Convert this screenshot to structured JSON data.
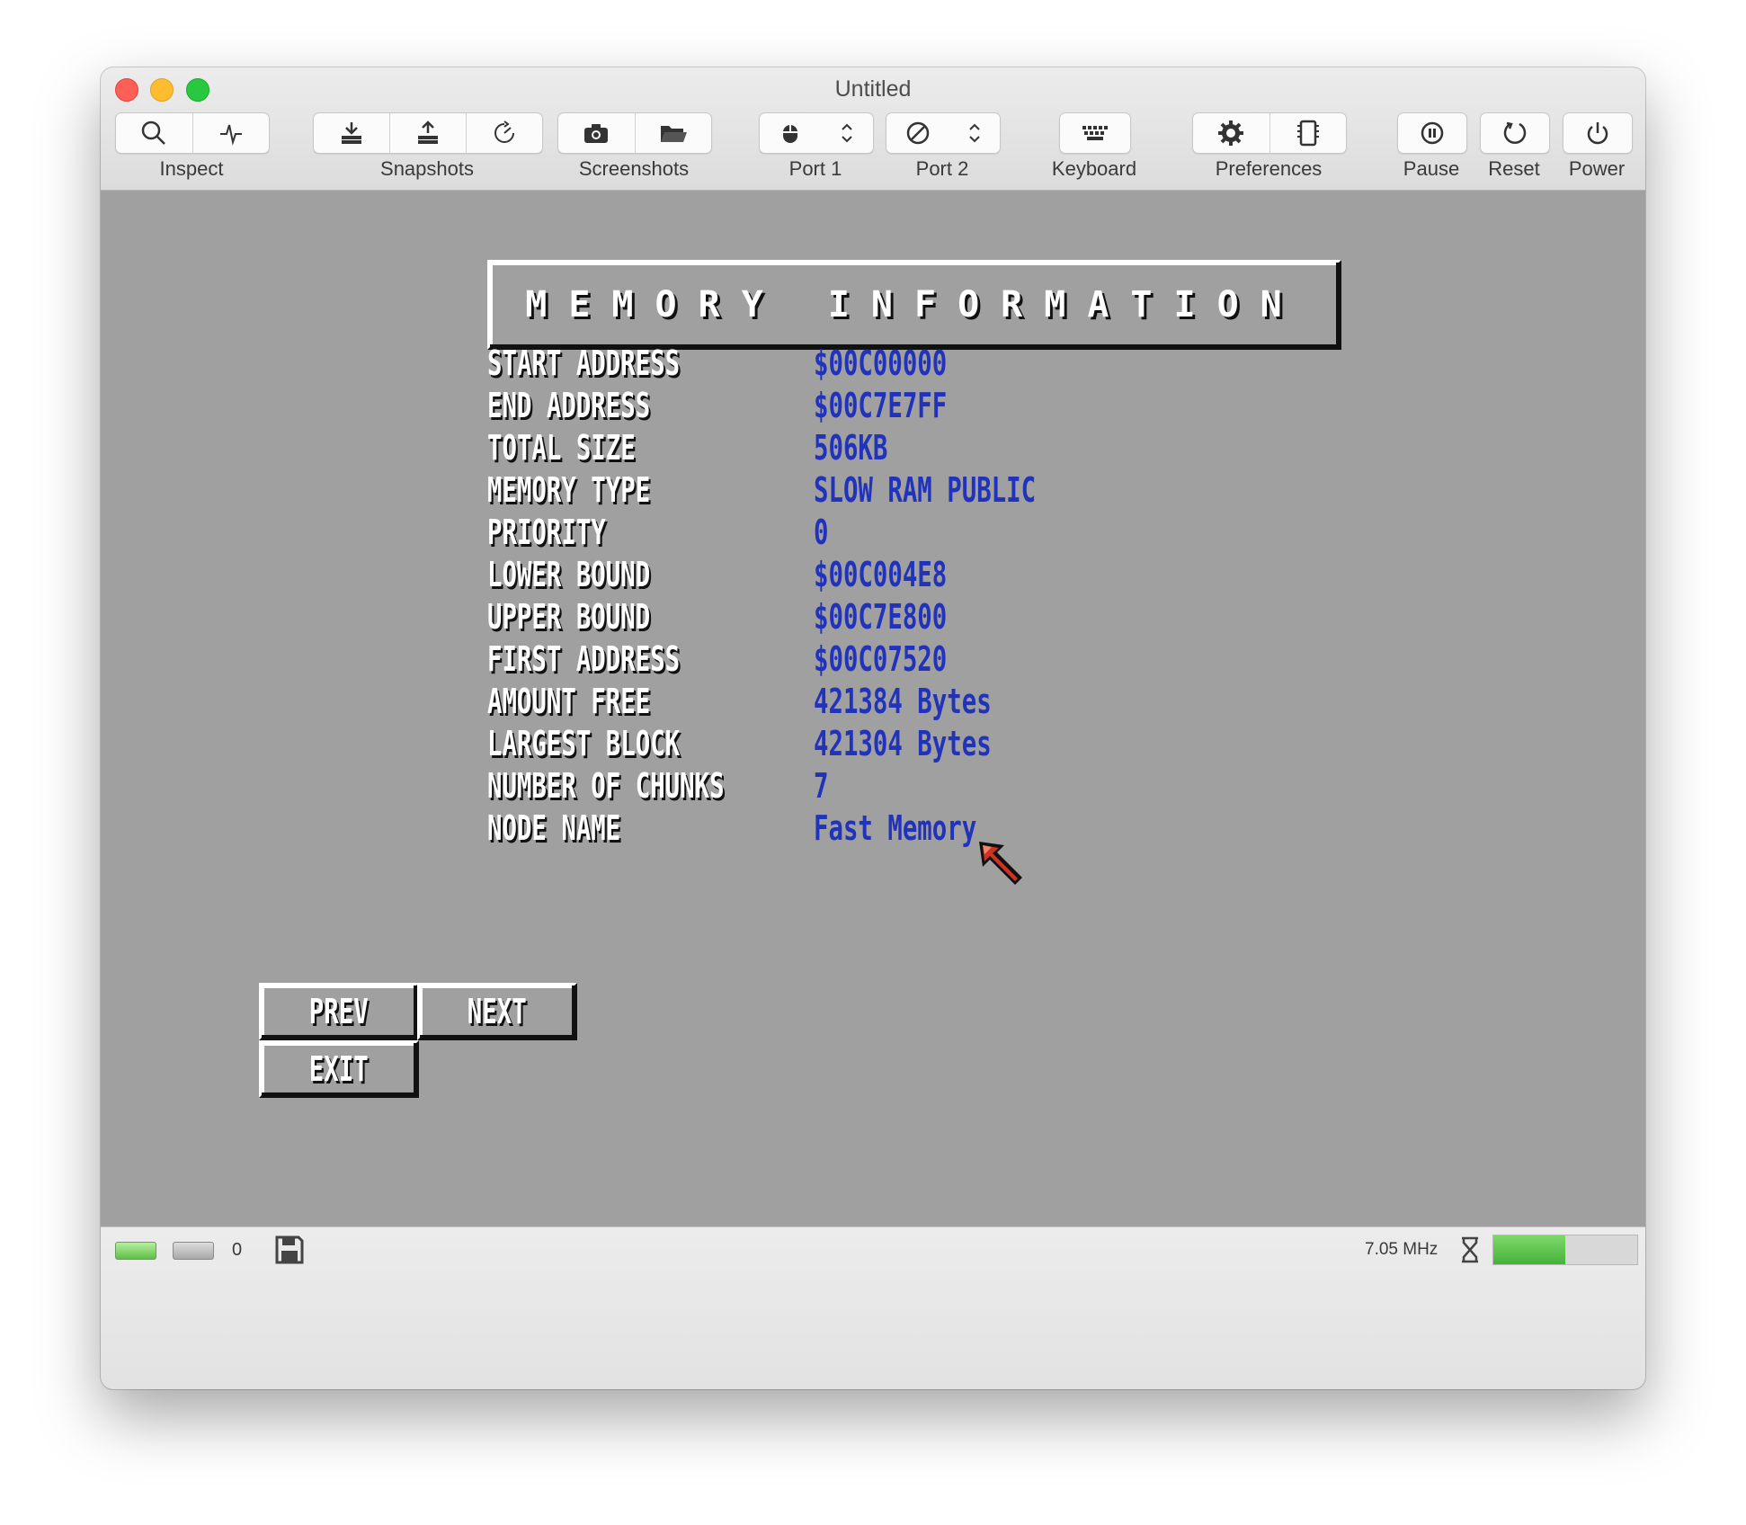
{
  "window": {
    "title": "Untitled"
  },
  "toolbar": {
    "inspect_label": "Inspect",
    "snapshots_label": "Snapshots",
    "screenshots_label": "Screenshots",
    "port1_label": "Port 1",
    "port2_label": "Port 2",
    "keyboard_label": "Keyboard",
    "preferences_label": "Preferences",
    "pause_label": "Pause",
    "reset_label": "Reset",
    "power_label": "Power"
  },
  "screen": {
    "title": "MEMORY INFORMATION",
    "rows": [
      {
        "label": "START ADDRESS",
        "value": "$00C00000"
      },
      {
        "label": "END ADDRESS",
        "value": "$00C7E7FF"
      },
      {
        "label": "TOTAL SIZE",
        "value": "506KB"
      },
      {
        "label": "MEMORY TYPE",
        "value": "SLOW RAM  PUBLIC"
      },
      {
        "label": "PRIORITY",
        "value": "0"
      },
      {
        "label": "LOWER BOUND",
        "value": "$00C004E8"
      },
      {
        "label": "UPPER BOUND",
        "value": "$00C7E800"
      },
      {
        "label": "FIRST ADDRESS",
        "value": "$00C07520"
      },
      {
        "label": "AMOUNT FREE",
        "value": "421384 Bytes"
      },
      {
        "label": "LARGEST BLOCK",
        "value": "421304 Bytes"
      },
      {
        "label": "NUMBER OF CHUNKS",
        "value": "7"
      },
      {
        "label": "NODE NAME",
        "value": "Fast Memory"
      }
    ],
    "buttons": {
      "prev": "PREV",
      "next": "NEXT",
      "exit": "EXIT"
    },
    "colors": {
      "background": "#a0a0a0",
      "value_text": "#2233bb",
      "label_text": "#ffffff"
    }
  },
  "status": {
    "drive_count": "0",
    "clock": "7.05 MHz",
    "speed_fraction": 0.5
  },
  "icons": [
    "magnifier-icon",
    "activity-icon",
    "snapshot-save-icon",
    "snapshot-load-icon",
    "snapshot-timer-icon",
    "camera-icon",
    "folder-icon",
    "mouse-icon",
    "chevron-updown-icon",
    "no-device-icon",
    "keyboard-icon",
    "gear-icon",
    "memory-card-icon",
    "pause-icon",
    "reset-icon",
    "power-icon",
    "hourglass-icon",
    "floppy-icon",
    "amiga-pointer-icon"
  ]
}
